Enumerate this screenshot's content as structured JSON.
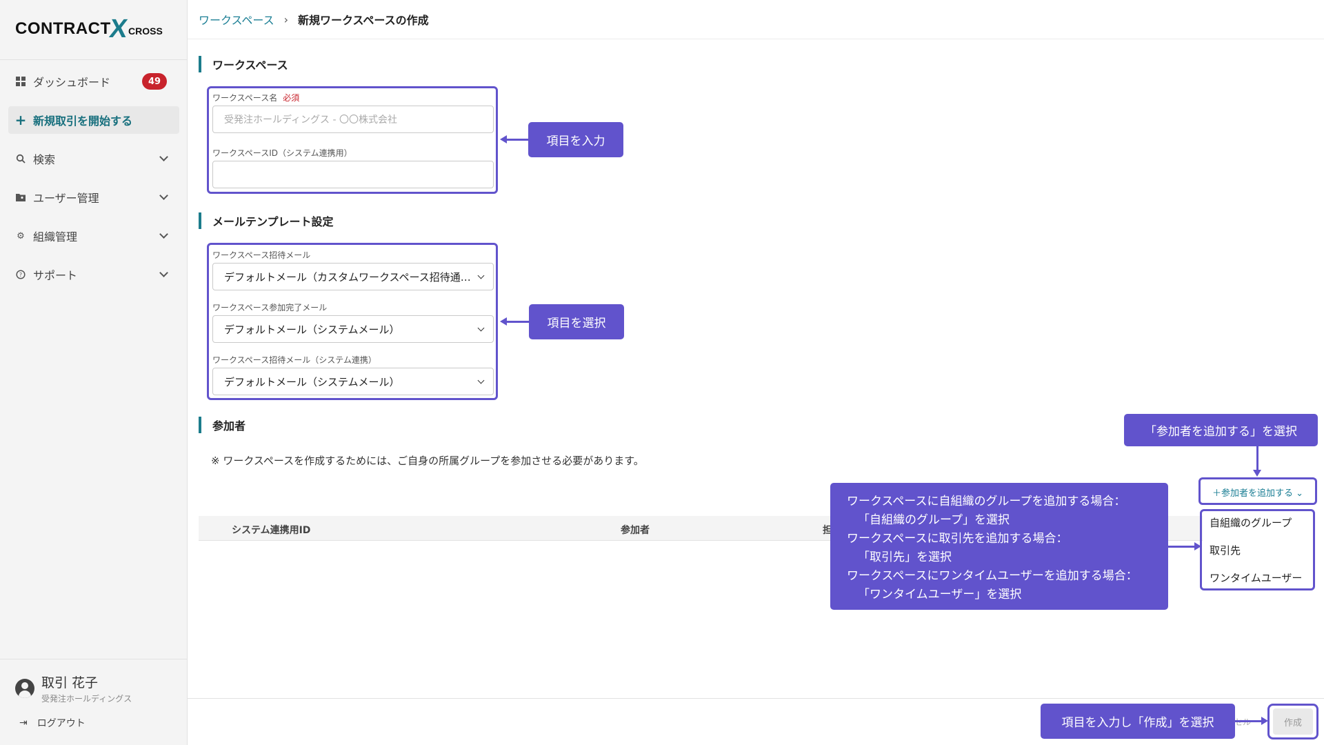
{
  "brand": {
    "logo_left": "CONTRACT",
    "logo_x": "X",
    "logo_right": "CROSS"
  },
  "sidebar": {
    "items": [
      {
        "label": "ダッシュボード",
        "badge": "49"
      },
      {
        "label": "新規取引を開始する"
      },
      {
        "label": "検索"
      },
      {
        "label": "ユーザー管理"
      },
      {
        "label": "組織管理"
      },
      {
        "label": "サポート"
      }
    ],
    "user": {
      "name": "取引 花子",
      "org": "受発注ホールディングス"
    },
    "logout": "ログアウト"
  },
  "breadcrumb": {
    "parent": "ワークスペース",
    "sep": "›",
    "current": "新規ワークスペースの作成"
  },
  "workspace": {
    "section_title": "ワークスペース",
    "name_label": "ワークスペース名",
    "required": "必須",
    "name_placeholder": "受発注ホールディングス - 〇〇株式会社",
    "id_label": "ワークスペースID（システム連携用）",
    "id_value": ""
  },
  "mail": {
    "section_title": "メールテンプレート設定",
    "invite_label": "ワークスペース招待メール",
    "invite_value": "デフォルトメール（カスタムワークスペース招待通知メール）",
    "complete_label": "ワークスペース参加完了メール",
    "complete_value": "デフォルトメール（システムメール）",
    "system_label": "ワークスペース招待メール（システム連携）",
    "system_value": "デフォルトメール（システムメール）"
  },
  "participants": {
    "section_title": "参加者",
    "note": "※ ワークスペースを作成するためには、ご自身の所属グループを参加させる必要があります。",
    "columns": [
      "システム連携用ID",
      "参加者",
      "担"
    ],
    "add_button": "＋参加者を追加する ⌄",
    "dropdown": [
      "自組織のグループ",
      "取引先",
      "ワンタイムユーザー"
    ]
  },
  "callouts": {
    "input": "項目を入力",
    "select": "項目を選択",
    "add": "「参加者を追加する」を選択",
    "info": [
      "ワークスペースに自組織のグループを追加する場合：",
      "「自組織のグループ」を選択",
      "ワークスペースに取引先を追加する場合：",
      "「取引先」を選択",
      "ワークスペースにワンタイムユーザーを追加する場合：",
      "「ワンタイムユーザー」を選択"
    ],
    "create": "項目を入力し「作成」を選択"
  },
  "footer": {
    "cancel_ghost": "セル",
    "create": "作成"
  },
  "colors": {
    "accent": "#1c7c8c",
    "annotation": "#6153cc",
    "badge": "#c8232c"
  }
}
